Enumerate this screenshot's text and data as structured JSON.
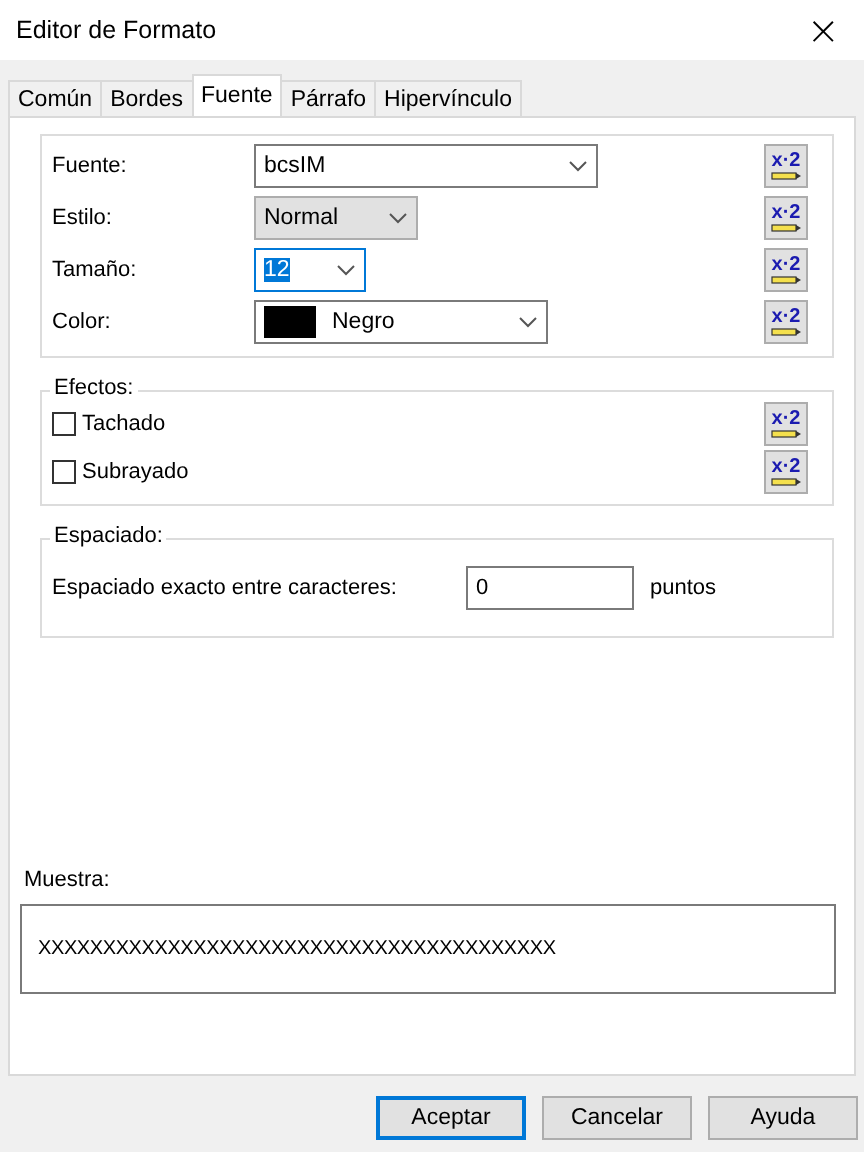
{
  "window": {
    "title": "Editor de Formato",
    "close": "×"
  },
  "tabs": [
    {
      "label": "Común",
      "selected": false
    },
    {
      "label": "Bordes",
      "selected": false
    },
    {
      "label": "Fuente",
      "selected": true
    },
    {
      "label": "Párrafo",
      "selected": false
    },
    {
      "label": "Hipervínculo",
      "selected": false
    }
  ],
  "font_group": {
    "rows": [
      {
        "label": "Fuente:",
        "kind": "combo",
        "value": "bcsIM",
        "focused": false,
        "reset": "x·2"
      },
      {
        "label": "Estilo:",
        "kind": "dropdown",
        "value": "Normal",
        "focused": false,
        "reset": "x·2"
      },
      {
        "label": "Tamaño:",
        "kind": "combo",
        "value": "12",
        "focused": true,
        "reset": "x·2"
      },
      {
        "label": "Color:",
        "kind": "color",
        "value": "Negro",
        "color": "#000000",
        "focused": false,
        "reset": "x·2"
      }
    ]
  },
  "effects": {
    "title": "Efectos:",
    "items": [
      {
        "label": "Tachado",
        "checked": false,
        "reset": "x·2"
      },
      {
        "label": "Subrayado",
        "checked": false,
        "reset": "x·2"
      }
    ]
  },
  "spacing": {
    "title": "Espaciado:",
    "label": "Espaciado exacto entre caracteres:",
    "value": "0",
    "unit": "puntos"
  },
  "sample": {
    "label": "Muestra:",
    "text": "XXXXXXXXXXXXXXXXXXXXXXXXXXXXXXXXXXXXXXXX"
  },
  "buttons": [
    {
      "label": "Aceptar",
      "default": true
    },
    {
      "label": "Cancelar",
      "default": false
    },
    {
      "label": "Ayuda",
      "default": false
    }
  ]
}
